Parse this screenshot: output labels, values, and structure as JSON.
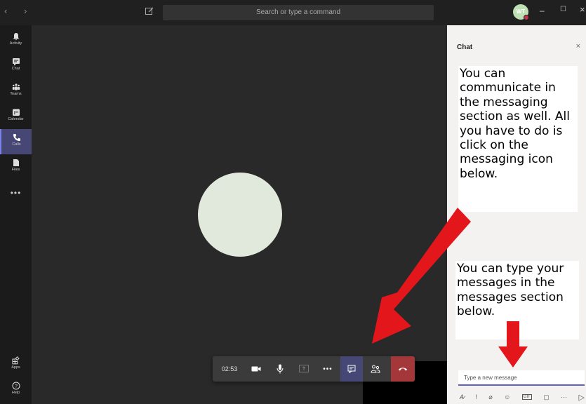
{
  "titlebar": {
    "search_placeholder": "Search or type a command",
    "avatar_initials": "WT",
    "minimize": "–",
    "maximize": "☐",
    "close": "×",
    "nav": "‹ ›"
  },
  "rail": {
    "items": [
      {
        "label": "Activity",
        "icon": "bell-icon"
      },
      {
        "label": "Chat",
        "icon": "chat-icon"
      },
      {
        "label": "Teams",
        "icon": "teams-icon"
      },
      {
        "label": "Calendar",
        "icon": "calendar-icon"
      },
      {
        "label": "Calls",
        "icon": "phone-icon",
        "active": true
      },
      {
        "label": "Files",
        "icon": "file-icon"
      }
    ],
    "more": "•••",
    "bottom": [
      {
        "label": "Apps",
        "icon": "apps-icon"
      },
      {
        "label": "Help",
        "icon": "help-icon"
      }
    ]
  },
  "call": {
    "timer": "02:53",
    "more": "•••"
  },
  "chat": {
    "title": "Chat",
    "close": "×",
    "note1": "You can communicate in the messaging section as well. All you have to do is click on the messaging icon below.",
    "note2": "You can type your messages in the messages section below.",
    "input_placeholder": "Type a new message"
  },
  "colors": {
    "accent": "#6264a7",
    "active_rail": "#464775",
    "hangup": "#a4373a",
    "arrow": "#e3171b"
  }
}
